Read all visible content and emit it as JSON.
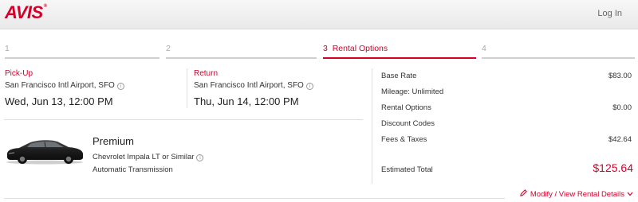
{
  "header": {
    "logo_text": "AVIS",
    "logo_mark": "®",
    "login_label": "Log In",
    "brand_color": "#d4002a"
  },
  "steps": [
    {
      "number": "1",
      "label": ""
    },
    {
      "number": "2",
      "label": ""
    },
    {
      "number": "3",
      "label": "Rental Options",
      "active": true
    },
    {
      "number": "4",
      "label": ""
    }
  ],
  "pickup": {
    "label": "Pick-Up",
    "location": "San Francisco Intl Airport, SFO",
    "datetime": "Wed, Jun 13, 12:00 PM",
    "info_icon": "info-icon"
  },
  "return": {
    "label": "Return",
    "location": "San Francisco Intl Airport, SFO",
    "datetime": "Thu, Jun 14, 12:00 PM",
    "info_icon": "info-icon"
  },
  "vehicle": {
    "class": "Premium",
    "model": "Chevrolet Impala LT or Similar",
    "transmission": "Automatic Transmission",
    "image": "car-image"
  },
  "summary": {
    "base_rate_label": "Base Rate",
    "base_rate_value": "$83.00",
    "mileage_label": "Mileage: Unlimited",
    "rental_options_label": "Rental Options",
    "rental_options_value": "$0.00",
    "discount_label": "Discount Codes",
    "fees_label": "Fees & Taxes",
    "fees_value": "$42.64",
    "total_label": "Estimated Total",
    "total_value": "$125.64"
  },
  "modify_link": {
    "label": "Modify / View Rental Details",
    "icon": "pencil-icon",
    "chevron": "chevron-down-icon"
  }
}
